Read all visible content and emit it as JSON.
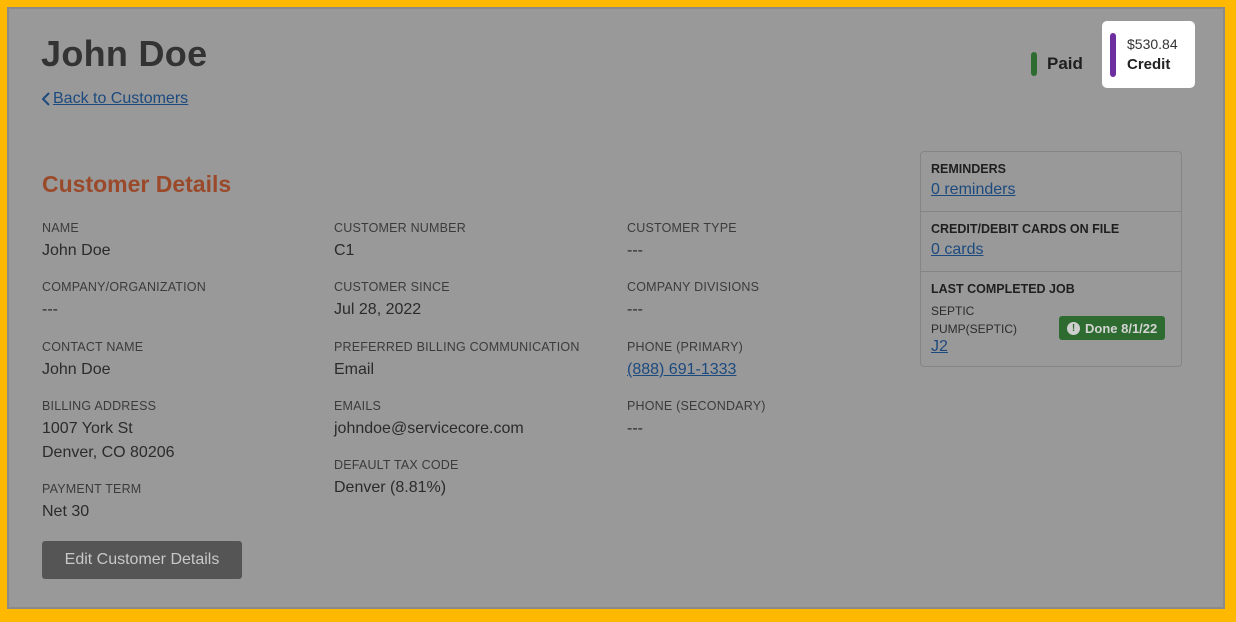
{
  "header": {
    "title": "John Doe",
    "back_link": "Back to Customers",
    "paid_label": "Paid",
    "credit_amount": "$530.84",
    "credit_label": "Credit"
  },
  "details": {
    "section_title": "Customer Details",
    "name": {
      "label": "NAME",
      "value": "John Doe"
    },
    "company": {
      "label": "COMPANY/ORGANIZATION",
      "value": "---"
    },
    "contact": {
      "label": "CONTACT NAME",
      "value": "John Doe"
    },
    "billing": {
      "label": "BILLING ADDRESS",
      "line1": "1007 York St",
      "line2": "Denver, CO 80206"
    },
    "payment_term": {
      "label": "PAYMENT TERM",
      "value": "Net 30"
    },
    "customer_number": {
      "label": "CUSTOMER NUMBER",
      "value": "C1"
    },
    "customer_since": {
      "label": "CUSTOMER SINCE",
      "value": "Jul 28, 2022"
    },
    "billing_comm": {
      "label": "PREFERRED BILLING COMMUNICATION",
      "value": "Email"
    },
    "emails": {
      "label": "EMAILS",
      "value": "johndoe@servicecore.com"
    },
    "tax_code": {
      "label": "DEFAULT TAX CODE",
      "value": "Denver (8.81%)"
    },
    "customer_type": {
      "label": "CUSTOMER TYPE",
      "value": "---"
    },
    "divisions": {
      "label": "COMPANY DIVISIONS",
      "value": "---"
    },
    "phone_primary": {
      "label": "PHONE (PRIMARY)",
      "value": "(888) 691-1333"
    },
    "phone_secondary": {
      "label": "PHONE (SECONDARY)",
      "value": "---"
    },
    "edit_button": "Edit Customer Details"
  },
  "side": {
    "reminders": {
      "heading": "REMINDERS",
      "link": "0 reminders"
    },
    "cards": {
      "heading": "CREDIT/DEBIT CARDS ON FILE",
      "link": "0 cards"
    },
    "last_job": {
      "heading": "LAST COMPLETED JOB",
      "name_line1": "SEPTIC",
      "name_line2": "PUMP(SEPTIC)",
      "badge": "Done 8/1/22",
      "link": "J2"
    }
  },
  "colors": {
    "background_overlay": "#999999",
    "frame": "#ffb800",
    "accent_title": "#9a4a2b",
    "link": "#1c4a7f",
    "paid": "#2e6b30",
    "credit": "#6d2f9f"
  },
  "icons": {
    "back": "chevron-left-icon",
    "badge": "alert-circle-icon"
  }
}
